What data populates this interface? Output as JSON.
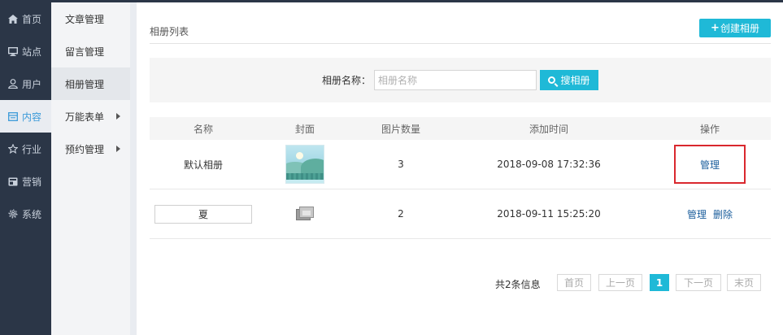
{
  "nav": {
    "items": [
      {
        "label": "首页",
        "icon": "home-icon"
      },
      {
        "label": "站点",
        "icon": "monitor-icon"
      },
      {
        "label": "用户",
        "icon": "user-icon"
      },
      {
        "label": "内容",
        "icon": "content-icon"
      },
      {
        "label": "行业",
        "icon": "star-icon"
      },
      {
        "label": "营销",
        "icon": "marketing-icon"
      },
      {
        "label": "系统",
        "icon": "gear-icon"
      }
    ],
    "active": "内容"
  },
  "subnav": {
    "items": [
      {
        "label": "文章管理"
      },
      {
        "label": "留言管理"
      },
      {
        "label": "相册管理"
      },
      {
        "label": "万能表单"
      },
      {
        "label": "预约管理"
      }
    ],
    "active": "相册管理"
  },
  "page": {
    "title": "相册列表",
    "create_label": "创建相册",
    "create_plus": "+"
  },
  "search": {
    "label": "相册名称：",
    "placeholder": "相册名称",
    "value": "",
    "button_label": "搜相册"
  },
  "table": {
    "columns": [
      "名称",
      "封面",
      "图片数量",
      "添加时间",
      "操作"
    ],
    "rows": [
      {
        "name": "默认相册",
        "count": "3",
        "time": "2018-09-08 17:32:36",
        "actions": [
          "管理"
        ]
      },
      {
        "name": "夏",
        "count": "2",
        "time": "2018-09-11 15:25:20",
        "actions": [
          "管理",
          "删除"
        ]
      }
    ]
  },
  "pager": {
    "total": "共2条信息",
    "first": "首页",
    "prev": "上一页",
    "current": "1",
    "next": "下一页",
    "last": "末页"
  },
  "colors": {
    "sidebar": "#2b3647",
    "accent": "#1fb9d7",
    "highlight_border": "#d9282e",
    "link": "#1a5d9c"
  }
}
